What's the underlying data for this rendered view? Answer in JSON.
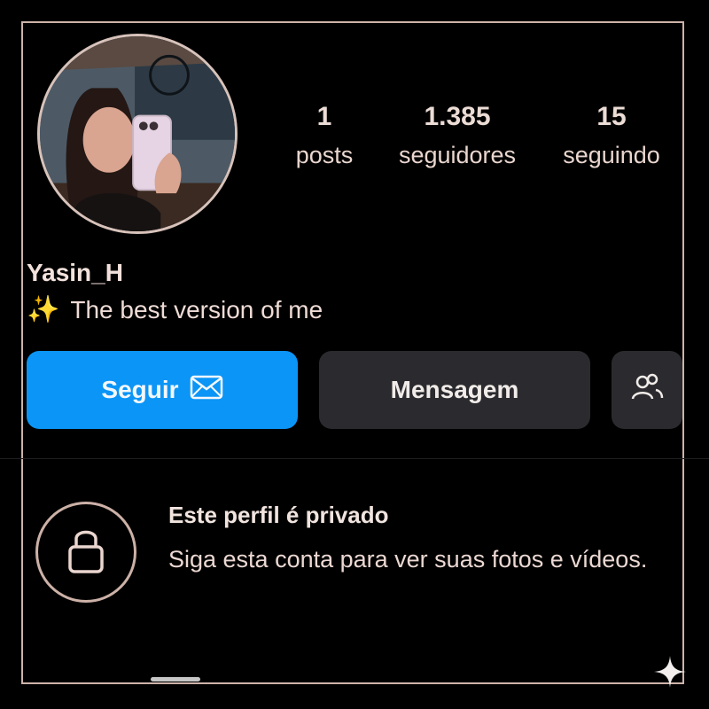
{
  "profile": {
    "username": "Yasin_H",
    "bio_emoji": "✨",
    "bio_text": "The best version of me"
  },
  "stats": [
    {
      "value": "1",
      "label": "posts"
    },
    {
      "value": "1.385",
      "label": "seguidores"
    },
    {
      "value": "15",
      "label": "seguindo"
    }
  ],
  "buttons": {
    "follow": "Seguir",
    "message": "Mensagem"
  },
  "private": {
    "title": "Este perfil é privado",
    "body": "Siga esta conta para ver suas fotos e vídeos."
  },
  "icons": {
    "follow": "envelope-icon",
    "suggested": "people-icon",
    "private": "lock-icon",
    "corner": "sparkle-icon"
  },
  "colors": {
    "follow_button": "#0b95f6",
    "secondary_button": "#2b2b2f",
    "frame": "#cdb3aa"
  }
}
